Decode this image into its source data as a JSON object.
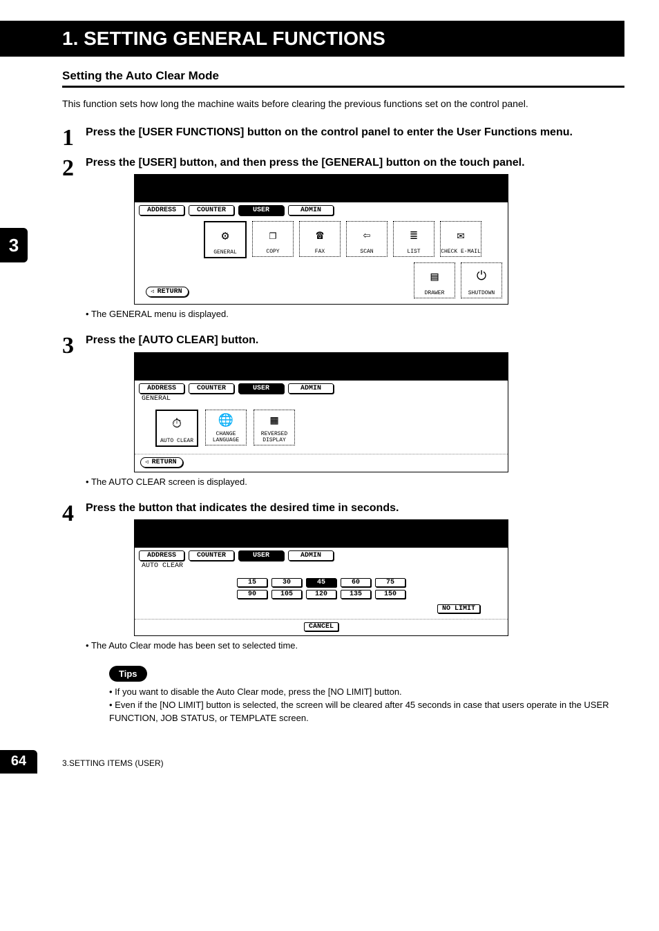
{
  "chapter": {
    "title": "1. SETTING GENERAL FUNCTIONS"
  },
  "section": {
    "title": "Setting the Auto Clear Mode"
  },
  "intro": "This function sets how long the machine waits before clearing the previous functions set on the control panel.",
  "side_tab": "3",
  "steps": [
    {
      "num": "1",
      "text": "Press the [USER FUNCTIONS] button on the control panel to enter the User Functions menu."
    },
    {
      "num": "2",
      "text": "Press the [USER] button, and then press the [GENERAL] button on the touch panel.",
      "note": "The GENERAL menu is displayed."
    },
    {
      "num": "3",
      "text": "Press the [AUTO CLEAR] button.",
      "note": "The AUTO CLEAR screen is displayed."
    },
    {
      "num": "4",
      "text": "Press the button that indicates the desired time in seconds.",
      "note": "The Auto Clear mode has been set to selected time."
    }
  ],
  "panel_tabs": {
    "address": "ADDRESS",
    "counter": "COUNTER",
    "user": "USER",
    "admin": "ADMIN"
  },
  "screen1": {
    "row1": {
      "general": "GENERAL",
      "copy": "COPY",
      "fax": "FAX",
      "scan": "SCAN",
      "list": "LIST",
      "email": "CHECK E-MAIL"
    },
    "row2": {
      "drawer": "DRAWER",
      "shutdown": "SHUTDOWN"
    },
    "return": "RETURN"
  },
  "screen2": {
    "breadcrumb": "GENERAL",
    "buttons": {
      "autoclear": "AUTO CLEAR",
      "changelang": "CHANGE\nLANGUAGE",
      "reversed": "REVERSED\nDISPLAY"
    },
    "return": "RETURN"
  },
  "screen3": {
    "breadcrumb": "AUTO CLEAR",
    "times_row1": [
      "15",
      "30",
      "45",
      "60",
      "75"
    ],
    "times_row2": [
      "90",
      "105",
      "120",
      "135",
      "150"
    ],
    "active_time": "45",
    "nolimit": "NO LIMIT",
    "cancel": "CANCEL"
  },
  "tips": {
    "label": "Tips",
    "items": [
      "If you want to disable the Auto Clear mode, press the [NO LIMIT] button.",
      "Even if the [NO LIMIT] button is selected, the screen will be cleared after 45 seconds in case that users operate in the USER FUNCTION, JOB STATUS, or TEMPLATE screen."
    ]
  },
  "footer": {
    "page": "64",
    "text": "3.SETTING ITEMS (USER)"
  }
}
